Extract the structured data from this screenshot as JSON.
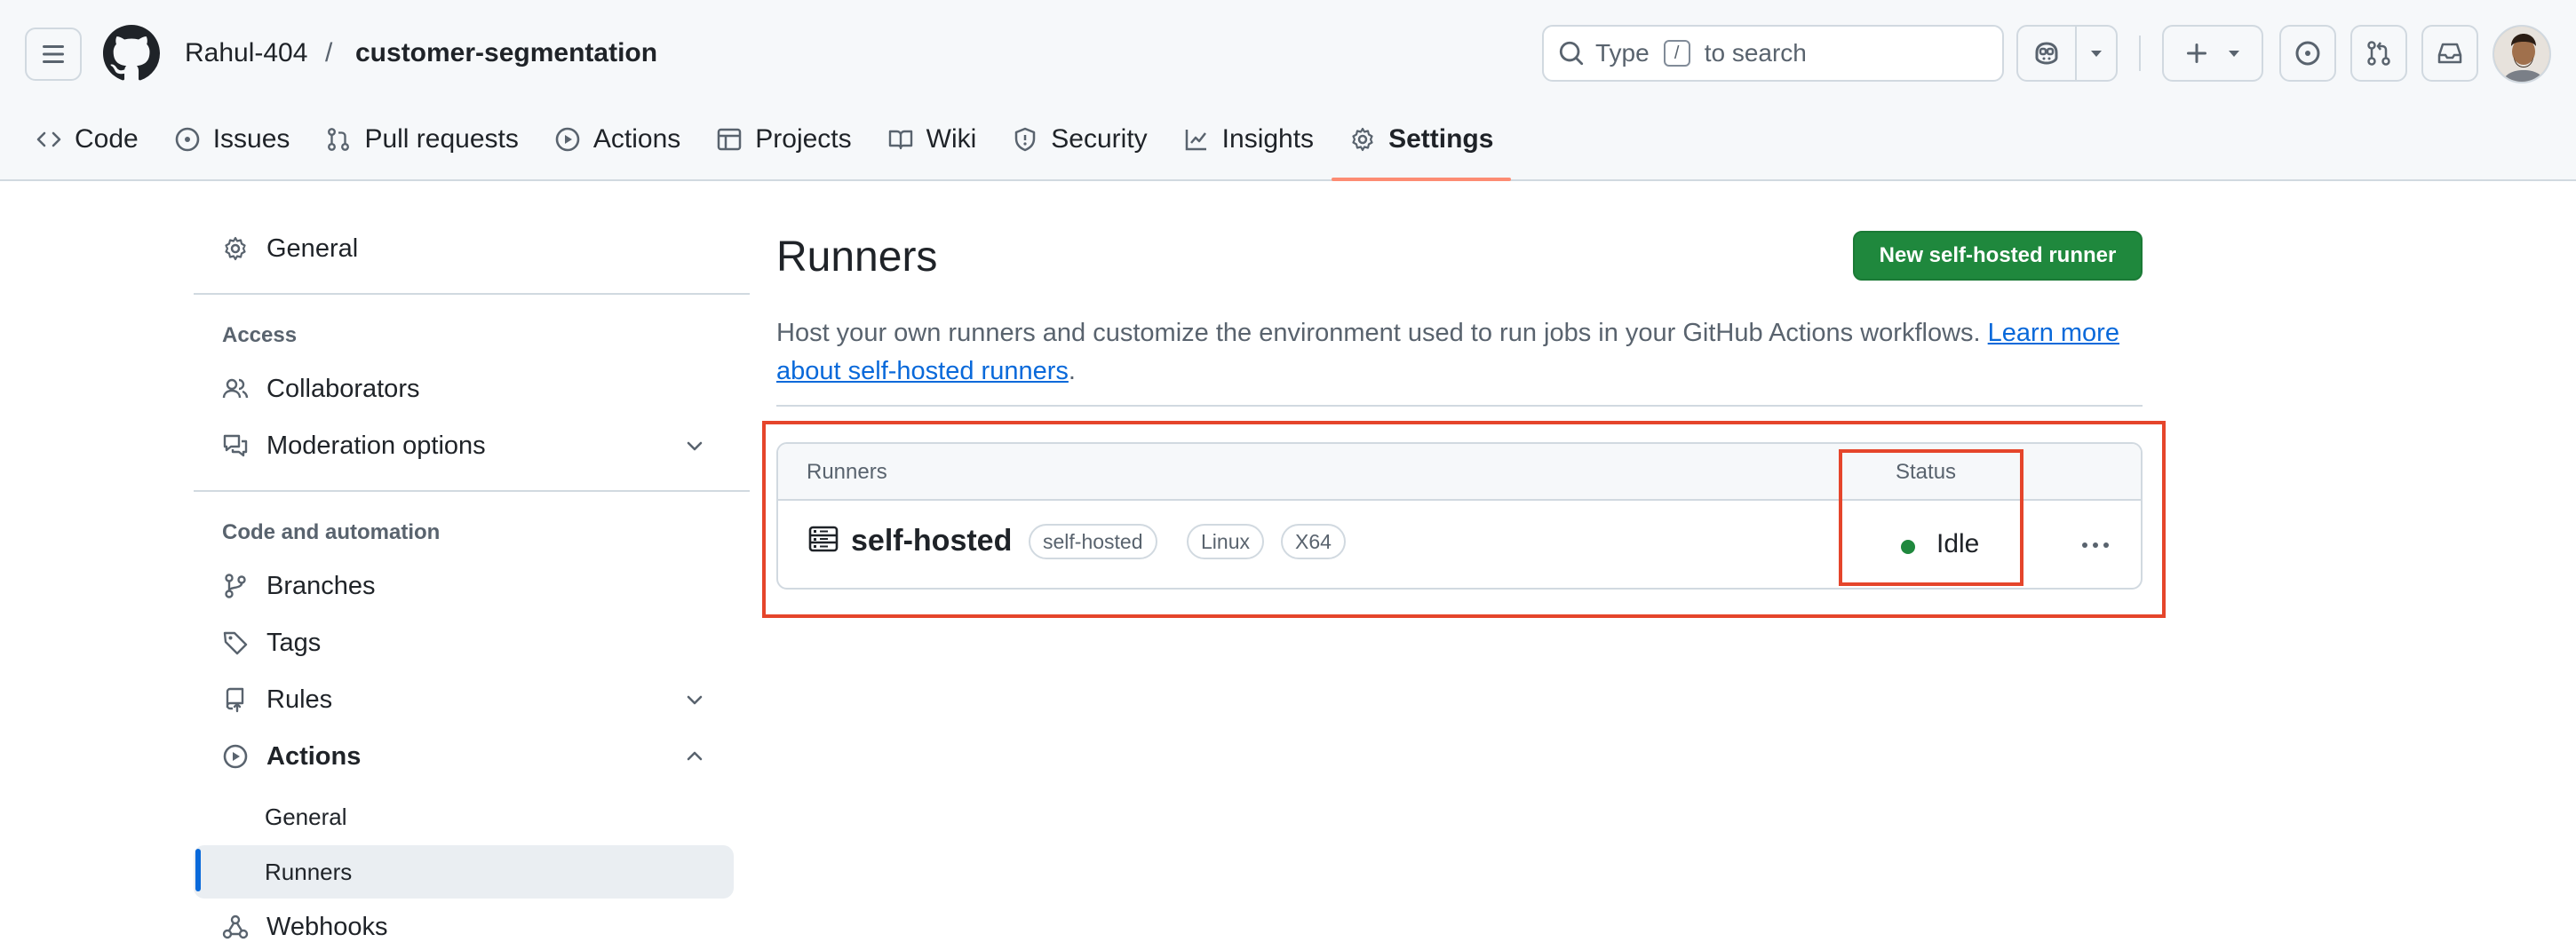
{
  "header": {
    "owner": "Rahul-404",
    "separator": "/",
    "repo": "customer-segmentation",
    "search_prefix": "Type",
    "search_key": "/",
    "search_suffix": "to search"
  },
  "repo_tabs": [
    {
      "label": "Code",
      "icon": "code-icon"
    },
    {
      "label": "Issues",
      "icon": "issue-opened-icon"
    },
    {
      "label": "Pull requests",
      "icon": "git-pull-request-icon"
    },
    {
      "label": "Actions",
      "icon": "play-icon"
    },
    {
      "label": "Projects",
      "icon": "table-icon"
    },
    {
      "label": "Wiki",
      "icon": "book-icon"
    },
    {
      "label": "Security",
      "icon": "shield-icon"
    },
    {
      "label": "Insights",
      "icon": "graph-icon"
    },
    {
      "label": "Settings",
      "icon": "gear-icon",
      "selected": true
    }
  ],
  "sidebar": {
    "general": "General",
    "access_heading": "Access",
    "collaborators": "Collaborators",
    "moderation": "Moderation options",
    "code_heading": "Code and automation",
    "branches": "Branches",
    "tags": "Tags",
    "rules": "Rules",
    "actions": "Actions",
    "actions_general": "General",
    "actions_runners": "Runners",
    "webhooks": "Webhooks"
  },
  "main": {
    "title": "Runners",
    "new_runner_button": "New self-hosted runner",
    "description": "Host your own runners and customize the environment used to run jobs in your GitHub Actions workflows.",
    "learn_more": "Learn more about self-hosted runners",
    "period": ".",
    "table": {
      "col_runners": "Runners",
      "col_status": "Status",
      "rows": [
        {
          "name": "self-hosted",
          "labels": [
            "self-hosted",
            "Linux",
            "X64"
          ],
          "status": "Idle"
        }
      ]
    }
  },
  "colors": {
    "accent_tab_underline": "#fd8c73",
    "primary_button": "#1f883d",
    "status_idle": "#1f883d",
    "link": "#0969da",
    "annotation_highlight": "#e5452b"
  }
}
